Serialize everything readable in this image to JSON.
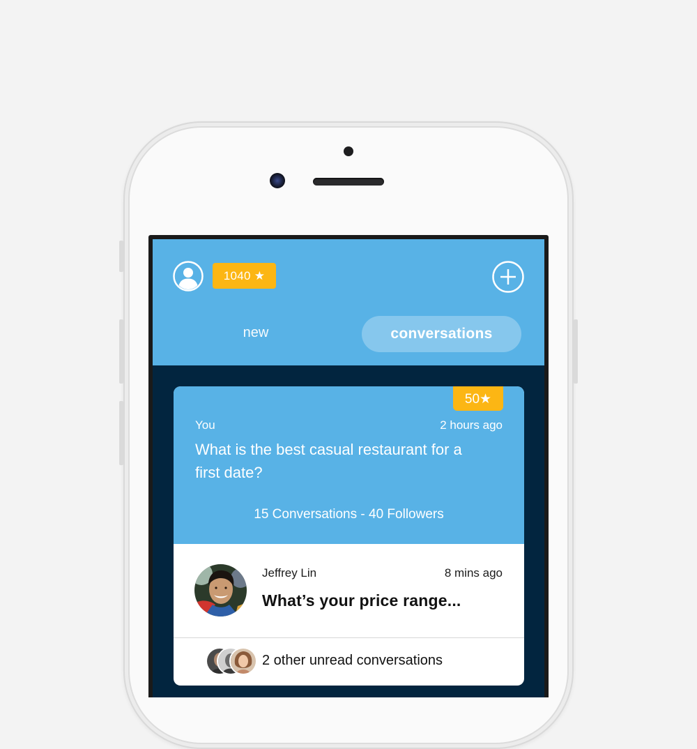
{
  "header": {
    "points_badge": "1040 ★",
    "tabs": [
      {
        "label": "new",
        "active": false
      },
      {
        "label": "conversations",
        "active": true
      }
    ]
  },
  "question_card": {
    "reward": "50★",
    "author": "You",
    "time": "2 hours ago",
    "question": "What is the best casual restaurant for a first date?",
    "stats": "15 Conversations - 40 Followers"
  },
  "reply": {
    "name": "Jeffrey Lin",
    "time": "8 mins ago",
    "text": "What’s your price range..."
  },
  "unread": {
    "text": "2 other unread conversations"
  },
  "colors": {
    "header_blue": "#58b2e6",
    "dark_navy": "#02253f",
    "badge_orange": "#fcb614"
  },
  "icons": {
    "profile": "user-circle-icon",
    "add": "plus-circle-icon"
  }
}
